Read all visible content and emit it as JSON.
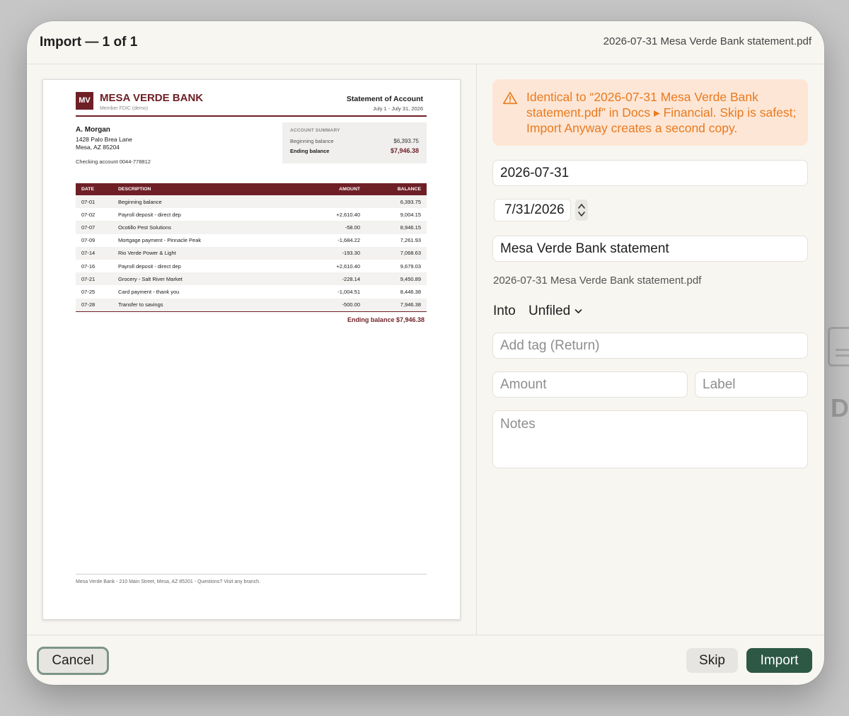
{
  "dialog": {
    "title": "Import — 1 of 1",
    "filename": "2026-07-31 Mesa Verde Bank statement.pdf"
  },
  "document": {
    "logo_text": "MV",
    "bank_name": "MESA VERDE BANK",
    "bank_sub": "Member FDIC (demo)",
    "statement_title": "Statement of Account",
    "period": "July 1 - July 31, 2026",
    "customer": {
      "name": "A. Morgan",
      "address1": "1428 Palo Brea Lane",
      "address2": "Mesa, AZ 85204",
      "account": "Checking account 0044-778812"
    },
    "summary": {
      "heading": "ACCOUNT SUMMARY",
      "beginning_label": "Beginning balance",
      "beginning_value": "$6,393.75",
      "ending_label": "Ending balance",
      "ending_value": "$7,946.38"
    },
    "table": {
      "headers": [
        "DATE",
        "DESCRIPTION",
        "AMOUNT",
        "BALANCE"
      ],
      "rows": [
        [
          "07-01",
          "Beginning balance",
          "",
          "6,393.75"
        ],
        [
          "07-02",
          "Payroll deposit - direct dep",
          "+2,610.40",
          "9,004.15"
        ],
        [
          "07-07",
          "Ocotillo Pest Solutions",
          "-58.00",
          "8,946.15"
        ],
        [
          "07-09",
          "Mortgage payment - Pinnacle Peak",
          "-1,684.22",
          "7,261.93"
        ],
        [
          "07-14",
          "Rio Verde Power & Light",
          "-193.30",
          "7,068.63"
        ],
        [
          "07-16",
          "Payroll deposit - direct dep",
          "+2,610.40",
          "9,679.03"
        ],
        [
          "07-21",
          "Grocery - Salt River Market",
          "-228.14",
          "9,450.89"
        ],
        [
          "07-25",
          "Card payment - thank you",
          "-1,004.51",
          "8,446.38"
        ],
        [
          "07-28",
          "Transfer to savings",
          "-500.00",
          "7,946.38"
        ]
      ]
    },
    "ending_total": "Ending balance $7,946.38",
    "footer": "Mesa Verde Bank - 210 Main Street, Mesa, AZ 85201 - Questions? Visit any branch."
  },
  "warning": {
    "text": "Identical to “2026-07-31 Mesa Verde Bank statement.pdf” in Docs ▸ Financial. Skip is safest; Import Anyway creates a second copy.",
    "color": "#e97a1f"
  },
  "form": {
    "date_text": "2026-07-31",
    "date_picker": "7/31/2026",
    "title": "Mesa Verde Bank statement",
    "original_filename": "2026-07-31 Mesa Verde Bank statement.pdf",
    "into_label": "Into",
    "into_value": "Unfiled",
    "tag_placeholder": "Add tag (Return)",
    "amount_placeholder": "Amount",
    "label_placeholder": "Label",
    "notes_placeholder": "Notes"
  },
  "buttons": {
    "cancel": "Cancel",
    "skip": "Skip",
    "import": "Import"
  },
  "background": {
    "letter": "D"
  },
  "colors": {
    "bank_accent": "#6e1f26",
    "primary_button": "#2e5846"
  }
}
